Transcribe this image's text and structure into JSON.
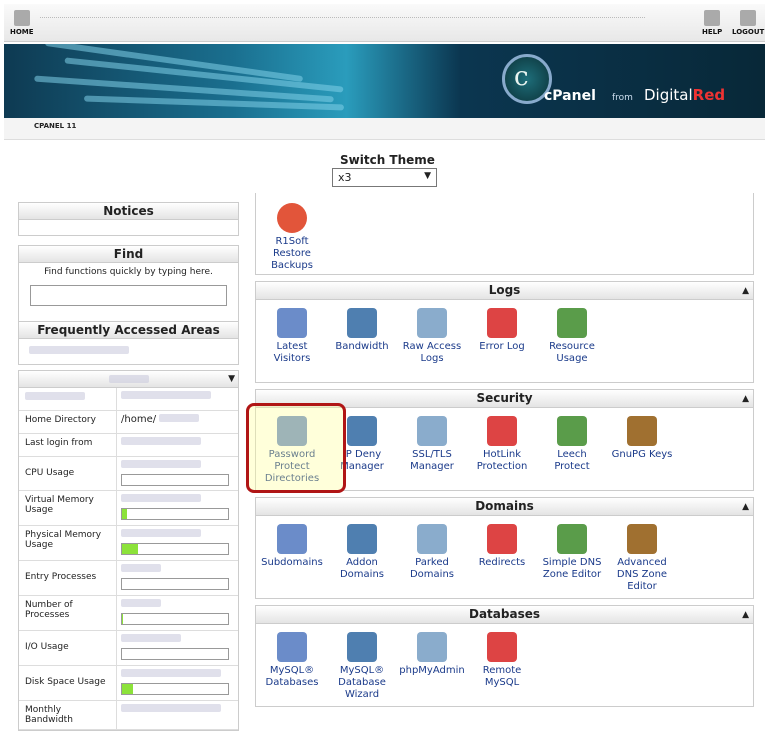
{
  "nav": {
    "home": "HOME",
    "help": "HELP",
    "logout": "LOGOUT"
  },
  "brand": {
    "text": "cPanel",
    "from": "from",
    "company": "Digital",
    "company_red": "Red",
    "version": "CPANEL 11"
  },
  "theme": {
    "label": "Switch Theme",
    "value": "x3"
  },
  "notices": {
    "title": "Notices"
  },
  "find": {
    "title": "Find",
    "hint": "Find functions quickly by typing here."
  },
  "faa": {
    "title": "Frequently Accessed Areas"
  },
  "stats": {
    "home_dir_label": "Home Directory",
    "home_dir_value": "/home/",
    "last_login": "Last login from",
    "cpu": "CPU Usage",
    "vmem": "Virtual Memory Usage",
    "pmem": "Physical Memory Usage",
    "entry": "Entry Processes",
    "nproc": "Number of Processes",
    "io": "I/O Usage",
    "disk": "Disk Space Usage",
    "bandwidth": "Monthly Bandwidth",
    "vmem_pct": 5,
    "pmem_pct": 15,
    "nproc_pct": 1,
    "disk_pct": 10
  },
  "panels": {
    "backups": {
      "r1soft": "R1Soft Restore Backups"
    },
    "logs": {
      "title": "Logs",
      "items": [
        "Latest Visitors",
        "Bandwidth",
        "Raw Access Logs",
        "Error Log",
        "Resource Usage"
      ]
    },
    "security": {
      "title": "Security",
      "items": [
        "Password Protect Directories",
        "IP Deny Manager",
        "SSL/TLS Manager",
        "HotLink Protection",
        "Leech Protect",
        "GnuPG Keys"
      ]
    },
    "domains": {
      "title": "Domains",
      "items": [
        "Subdomains",
        "Addon Domains",
        "Parked Domains",
        "Redirects",
        "Simple DNS Zone Editor",
        "Advanced DNS Zone Editor"
      ]
    },
    "databases": {
      "title": "Databases",
      "items": [
        "MySQL® Databases",
        "MySQL® Database Wizard",
        "phpMyAdmin",
        "Remote MySQL"
      ]
    }
  },
  "colors": {
    "accent": "#1a3a8a",
    "highlight": "#b01515",
    "bar": "#8ce23a"
  }
}
